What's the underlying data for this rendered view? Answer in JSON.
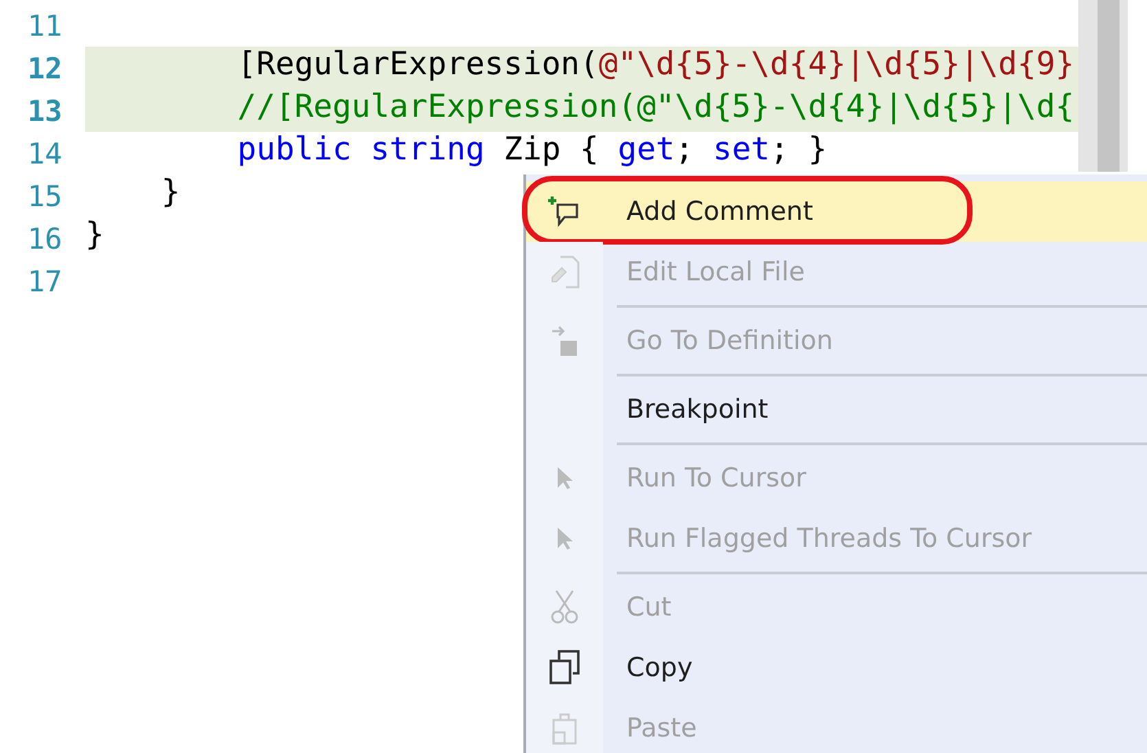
{
  "editor": {
    "lines": [
      {
        "number": "11",
        "highlighted": false
      },
      {
        "number": "12",
        "highlighted": true,
        "tokens": [
          {
            "text": "        [RegularExpression(",
            "kind": "plain"
          },
          {
            "text": "@\"\\d{5}-\\d{4}|\\d{5}|\\d{9}",
            "kind": "string"
          }
        ]
      },
      {
        "number": "13",
        "highlighted": true,
        "tokens": [
          {
            "text": "        //[RegularExpression(@\"\\d{5}-\\d{4}|\\d{5}|\\d{",
            "kind": "comment"
          }
        ]
      },
      {
        "number": "14",
        "highlighted": false,
        "tokens": [
          {
            "text": "        public string ",
            "kind": "keyword"
          },
          {
            "text": "Zip",
            "kind": "plain"
          },
          {
            "text": " { ",
            "kind": "plain"
          },
          {
            "text": "get",
            "kind": "keyword"
          },
          {
            "text": "; ",
            "kind": "plain"
          },
          {
            "text": "set",
            "kind": "keyword"
          },
          {
            "text": "; }",
            "kind": "plain"
          }
        ]
      },
      {
        "number": "15",
        "highlighted": false,
        "tokens": [
          {
            "text": "    }",
            "kind": "plain"
          }
        ]
      },
      {
        "number": "16",
        "highlighted": false,
        "tokens": [
          {
            "text": "}",
            "kind": "plain"
          }
        ]
      },
      {
        "number": "17",
        "highlighted": false
      }
    ]
  },
  "context_menu": {
    "items": [
      {
        "kind": "item",
        "label": "Add Comment",
        "disabled": false,
        "selected": true,
        "circled": true
      },
      {
        "kind": "item",
        "label": "Edit Local File",
        "disabled": true,
        "selected": false,
        "circled": false
      },
      {
        "kind": "separator"
      },
      {
        "kind": "item",
        "label": "Go To Definition",
        "disabled": true,
        "selected": false,
        "circled": false
      },
      {
        "kind": "separator"
      },
      {
        "kind": "item",
        "label": "Breakpoint",
        "disabled": false,
        "selected": false,
        "circled": false
      },
      {
        "kind": "separator"
      },
      {
        "kind": "item",
        "label": "Run To Cursor",
        "disabled": true,
        "selected": false,
        "circled": false
      },
      {
        "kind": "item",
        "label": "Run Flagged Threads To Cursor",
        "disabled": true,
        "selected": false,
        "circled": false
      },
      {
        "kind": "separator"
      },
      {
        "kind": "item",
        "label": "Cut",
        "disabled": true,
        "selected": false,
        "circled": false
      },
      {
        "kind": "item",
        "label": "Copy",
        "disabled": false,
        "selected": false,
        "circled": false
      },
      {
        "kind": "item",
        "label": "Paste",
        "disabled": true,
        "selected": false,
        "circled": false
      }
    ]
  }
}
